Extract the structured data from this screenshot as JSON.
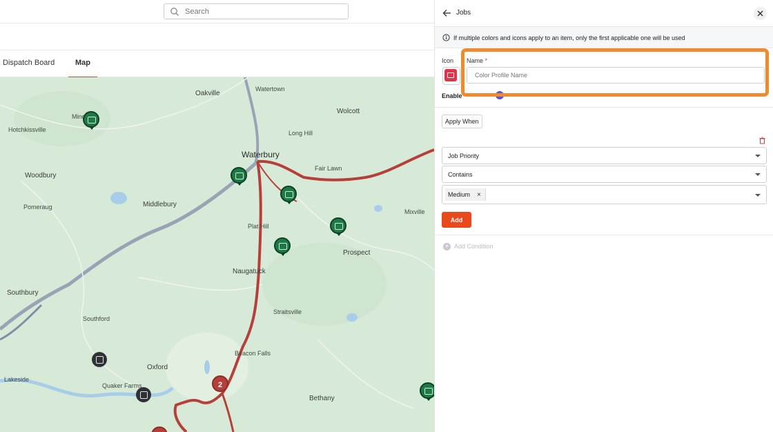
{
  "search": {
    "placeholder": "Search"
  },
  "tabs": [
    {
      "label": "Dispatch Board"
    },
    {
      "label": "Map"
    }
  ],
  "map": {
    "labels": [
      "Oakville",
      "Watertown",
      "Wolcott",
      "Hotchkissville",
      "Waterbury",
      "Woodbury",
      "Middlebury",
      "Pomeraug",
      "Prospect",
      "Naugatuck",
      "Southbury",
      "Southford",
      "Oxford",
      "Straitsville",
      "Beacon Falls",
      "Lakeside",
      "Quaker Farms",
      "Bethany",
      "Mixville",
      "Long Hill",
      "Fair Lawn",
      "Plat Hill",
      "Minor"
    ],
    "cluster_count": "2",
    "colors": {
      "road": "#b5403a",
      "water": "#a8cde8",
      "land": "#d7ead8"
    }
  },
  "panel": {
    "title": "Jobs",
    "info_text": "If multiple colors and icons apply to an item, only the first applicable one will be used",
    "icon_label": "Icon",
    "name_label": "Name",
    "name_required": "*",
    "name_placeholder": "Color Profile Name",
    "enable_label": "Enable",
    "apply_when_label": "Apply When",
    "field_select": "Job Priority",
    "operator_select": "Contains",
    "value_chip": "Medium",
    "chip_remove": "×",
    "add_label": "Add",
    "add_condition_label": "Add Condition",
    "accent_color": "#e8491d",
    "highlight_color": "#f08a2e"
  }
}
